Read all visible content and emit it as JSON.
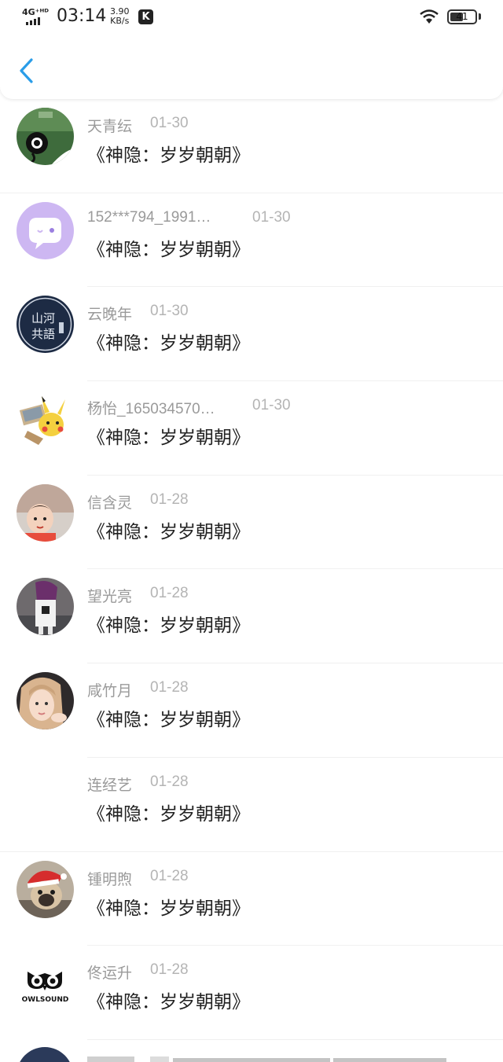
{
  "status_bar": {
    "network": "4G⁺ᴴᴰ",
    "time": "03:14",
    "speed_value": "3.90",
    "speed_unit": "KB/s",
    "app_badge": "K",
    "battery": "41"
  },
  "header": {
    "back_icon": "chevron-left-icon",
    "accent_color": "#2a9de8"
  },
  "items": [
    {
      "name": "天青纭",
      "date": "01-30",
      "title": "《神隐：岁岁朝朝》"
    },
    {
      "name": "152***794_1991…",
      "date": "01-30",
      "title": "《神隐：岁岁朝朝》"
    },
    {
      "name": "云晚年",
      "date": "01-30",
      "title": "《神隐：岁岁朝朝》"
    },
    {
      "name": "杨怡_165034570…",
      "date": "01-30",
      "title": "《神隐：岁岁朝朝》"
    },
    {
      "name": "信含灵",
      "date": "01-28",
      "title": "《神隐：岁岁朝朝》"
    },
    {
      "name": "望光亮",
      "date": "01-28",
      "title": "《神隐：岁岁朝朝》"
    },
    {
      "name": "咸竹月",
      "date": "01-28",
      "title": "《神隐：岁岁朝朝》"
    },
    {
      "name": "连经艺",
      "date": "01-28",
      "title": "《神隐：岁岁朝朝》"
    },
    {
      "name": "锺明煦",
      "date": "01-28",
      "title": "《神隐：岁岁朝朝》"
    },
    {
      "name": "佟运升",
      "date": "01-28",
      "title": "《神隐：岁岁朝朝》"
    }
  ],
  "avatar_texts": {
    "logo_text": "OWLSOUND",
    "seal_text": "山河共語"
  }
}
